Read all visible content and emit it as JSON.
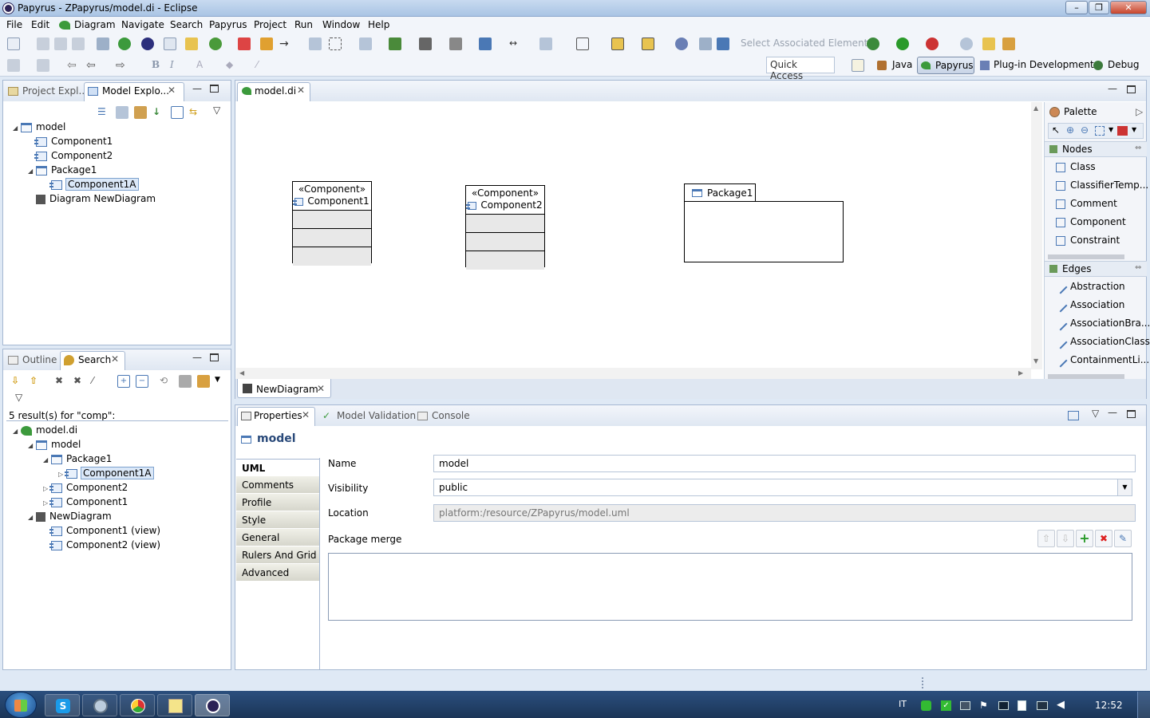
{
  "window": {
    "title": "Papyrus - ZPapyrus/model.di - Eclipse"
  },
  "menu": [
    "File",
    "Edit",
    "Diagram",
    "Navigate",
    "Search",
    "Papyrus",
    "Project",
    "Run",
    "Window",
    "Help"
  ],
  "toolbar": {
    "select_associated": "Select Associated Elements",
    "quick_access": "Quick Access"
  },
  "perspectives": [
    "Java",
    "Papyrus",
    "Plug-in Development",
    "Debug"
  ],
  "left_top": {
    "tabs": [
      "Project Expl...",
      "Model Explo..."
    ],
    "tree": [
      {
        "label": "model",
        "level": 0,
        "icon": "package-icon",
        "expanded": true
      },
      {
        "label": "Component1",
        "level": 1,
        "icon": "component-icon"
      },
      {
        "label": "Component2",
        "level": 1,
        "icon": "component-icon"
      },
      {
        "label": "Package1",
        "level": 1,
        "icon": "package-icon",
        "expanded": true
      },
      {
        "label": "Component1A",
        "level": 2,
        "icon": "component-icon",
        "selected": true
      },
      {
        "label": "Diagram NewDiagram",
        "level": 1,
        "icon": "diagram-icon"
      }
    ]
  },
  "left_bottom": {
    "tabs": [
      "Outline",
      "Search"
    ],
    "result": "5 result(s) for \"comp\":",
    "tree": [
      {
        "label": "model.di",
        "level": 0,
        "icon": "papyrus-icon",
        "expanded": true
      },
      {
        "label": "model",
        "level": 1,
        "icon": "package-icon",
        "expanded": true
      },
      {
        "label": "Package1",
        "level": 2,
        "icon": "package-icon",
        "expanded": true
      },
      {
        "label": "Component1A",
        "level": 3,
        "icon": "component-icon",
        "selected": true,
        "collapsed": true
      },
      {
        "label": "Component2",
        "level": 2,
        "icon": "component-icon",
        "collapsed": true
      },
      {
        "label": "Component1",
        "level": 2,
        "icon": "component-icon",
        "collapsed": true
      },
      {
        "label": "NewDiagram",
        "level": 1,
        "icon": "diagram-icon",
        "expanded": true
      },
      {
        "label": "Component1 (view)",
        "level": 2,
        "icon": "component-icon"
      },
      {
        "label": "Component2 (view)",
        "level": 2,
        "icon": "component-icon"
      }
    ]
  },
  "editor": {
    "tab": "model.di",
    "diagram_tab": "NewDiagram",
    "stereotype": "«Component»",
    "components": [
      "Component1",
      "Component2"
    ],
    "package": "Package1"
  },
  "palette": {
    "title": "Palette",
    "nodes_title": "Nodes",
    "nodes": [
      "Class",
      "ClassifierTemp...",
      "Comment",
      "Component",
      "Constraint"
    ],
    "edges_title": "Edges",
    "edges": [
      "Abstraction",
      "Association",
      "AssociationBra...",
      "AssociationClass",
      "ContainmentLi..."
    ]
  },
  "properties": {
    "tabs": [
      "Properties",
      "Model Validation",
      "Console"
    ],
    "heading": "model",
    "side_tabs": [
      "UML",
      "Comments",
      "Profile",
      "Style",
      "General",
      "Rulers And Grid",
      "Advanced"
    ],
    "name_label": "Name",
    "name_value": "model",
    "visibility_label": "Visibility",
    "visibility_value": "public",
    "location_label": "Location",
    "location_value": "platform:/resource/ZPapyrus/model.uml",
    "merge_label": "Package merge"
  },
  "taskbar": {
    "lang": "IT",
    "time": "12:52"
  }
}
